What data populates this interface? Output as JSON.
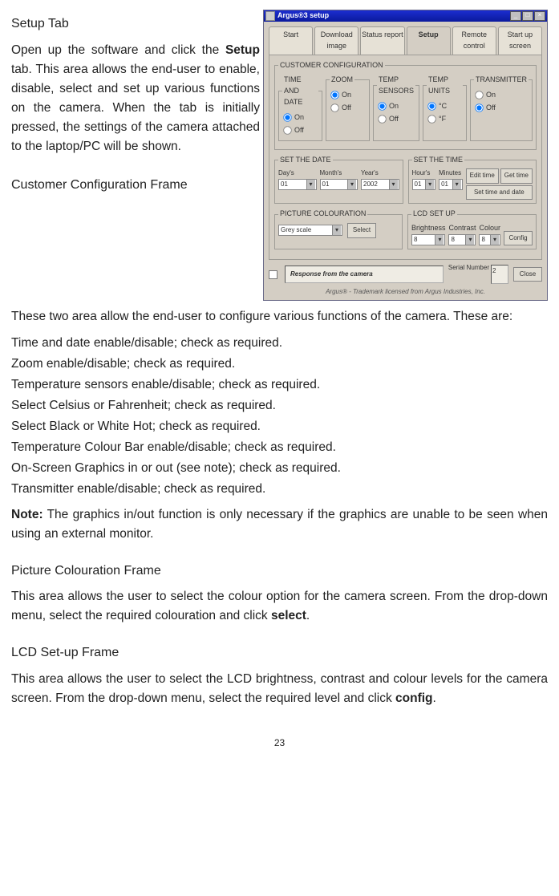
{
  "doc": {
    "heading_setup": "Setup Tab",
    "para_setup_1": "Open up the software and click the ",
    "para_setup_bold": "Setup",
    "para_setup_2": " tab. This area allows the end-user to enable, disable, select and set up various functions on the camera. When the tab is initially pressed, the settings of the camera attached to the laptop/PC will be shown.",
    "heading_cust": "Customer Configuration Frame",
    "para_cust": "These two area allow the end-user to configure various functions of the camera. These are:",
    "opt1": "Time and date enable/disable; check as required.",
    "opt2": "Zoom enable/disable; check as required.",
    "opt3": "Temperature sensors enable/disable; check as required.",
    "opt4": "Select Celsius or Fahrenheit; check as required.",
    "opt5": "Select Black or White Hot; check as required.",
    "opt6": "Temperature Colour Bar enable/disable; check as required.",
    "opt7": "On-Screen Graphics in or out (see note); check as required.",
    "opt8": "Transmitter enable/disable; check as required.",
    "note_label": "Note:",
    "note_text": " The graphics in/out function is only necessary if the graphics are unable to be seen when using an external monitor.",
    "heading_pic": "Picture Colouration Frame",
    "para_pic_1": "This area allows the user to select the colour option for the camera screen. From the drop-down menu, select the required colouration and click ",
    "para_pic_bold": "select",
    "para_pic_2": ".",
    "heading_lcd": "LCD Set-up Frame",
    "para_lcd_1": "This area allows the user to select the LCD brightness, contrast and colour levels for the camera screen. From the drop-down menu, select the required level and click ",
    "para_lcd_bold": "config",
    "para_lcd_2": ".",
    "pagenum": "23"
  },
  "app": {
    "title": "Argus®3 setup",
    "win_min": "_",
    "win_max": "□",
    "win_close": "×",
    "tabs": {
      "start": "Start",
      "download": "Download image",
      "status": "Status report",
      "setup": "Setup",
      "remote": "Remote control",
      "startup": "Start up screen"
    },
    "fs_customer": "CUSTOMER CONFIGURATION",
    "fs_time": "TIME AND DATE",
    "fs_zoom": "ZOOM",
    "fs_temp": "TEMP SENSORS",
    "fs_units": "TEMP UNITS",
    "fs_tx": "TRANSMITTER",
    "on": "On",
    "off": "Off",
    "c": "°C",
    "f": "°F",
    "fs_setdate": "SET THE DATE",
    "fs_settime": "SET THE TIME",
    "days": "Day's",
    "months": "Month's",
    "years": "Year's",
    "hours": "Hour's",
    "minutes": "Minutes",
    "d_day": "01",
    "d_month": "01",
    "d_year": "2002",
    "d_hour": "01",
    "d_min": "01",
    "btn_edittime": "Edit time",
    "btn_gettime": "Get time",
    "btn_settimedate": "Set time and date",
    "fs_piccol": "PICTURE COLOURATION",
    "piccol_val": "Grey scale",
    "btn_select": "Select",
    "fs_lcd": "LCD SET UP",
    "brightness": "Brightness",
    "contrast": "Contrast",
    "colour": "Colour",
    "lcd_val": "8",
    "btn_config": "Config",
    "response": "Response from the camera",
    "serial_label": "Serial Number",
    "serial_val": "2",
    "btn_close": "Close",
    "trademark": "Argus® - Trademark licensed from Argus Industries, Inc."
  }
}
